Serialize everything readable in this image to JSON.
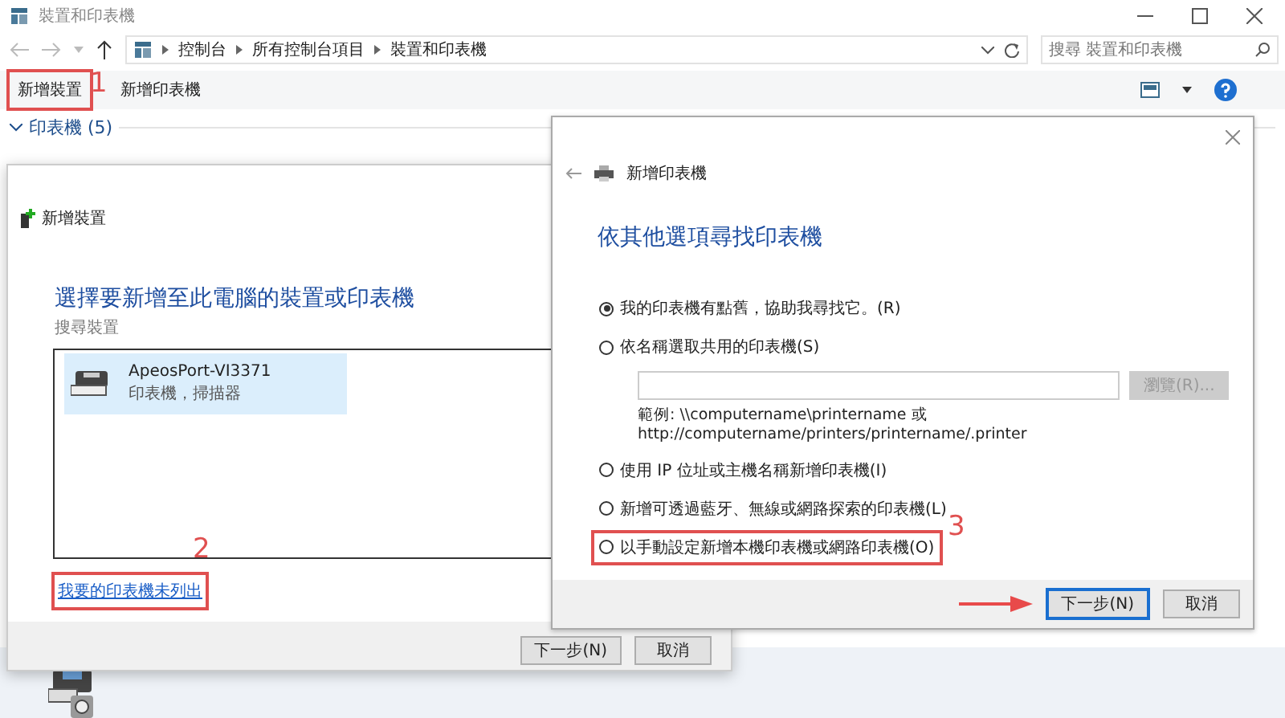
{
  "window": {
    "title": "裝置和印表機"
  },
  "address": {
    "breadcrumbs": [
      "控制台",
      "所有控制台項目",
      "裝置和印表機"
    ]
  },
  "search": {
    "placeholder": "搜尋 裝置和印表機"
  },
  "toolbar": {
    "buttons": [
      {
        "label": "新增裝置",
        "step": "1"
      },
      {
        "label": "新增印表機"
      }
    ]
  },
  "group": {
    "label": "印表機 (5)",
    "expanded": true
  },
  "add_device_dialog": {
    "title": "新增裝置",
    "heading": "選擇要新增至此電腦的裝置或印表機",
    "status": "搜尋裝置",
    "devices": [
      {
        "name": "ApeosPort-VI3371",
        "type": "印表機，掃描器",
        "selected": true
      }
    ],
    "link": {
      "label": "我要的印表機未列出",
      "step": "2"
    },
    "buttons": [
      "下一步(N)",
      "取消"
    ]
  },
  "add_printer_dialog": {
    "title": "新增印表機",
    "heading": "依其他選項尋找印表機",
    "options": [
      {
        "label": "我的印表機有點舊，協助我尋找它。(R)",
        "selected": true
      },
      {
        "label": "依名稱選取共用的印表機(S)",
        "selected": false,
        "kind": "field"
      },
      {
        "label": "使用 IP 位址或主機名稱新增印表機(I)",
        "selected": false
      },
      {
        "label": "新增可透過藍牙、無線或網路探索的印表機(L)",
        "selected": false
      },
      {
        "label": "以手動設定新增本機印表機或網路印表機(O)",
        "selected": false,
        "step": "3"
      }
    ],
    "browse": {
      "label": "瀏覽(R)...",
      "disabled": true
    },
    "example": [
      "範例: \\\\computername\\printername 或",
      "http://computername/printers/printername/.printer"
    ],
    "buttons": [
      {
        "label": "下一步(N)",
        "default": true,
        "pointed": true
      },
      {
        "label": "取消",
        "default": false
      }
    ]
  }
}
